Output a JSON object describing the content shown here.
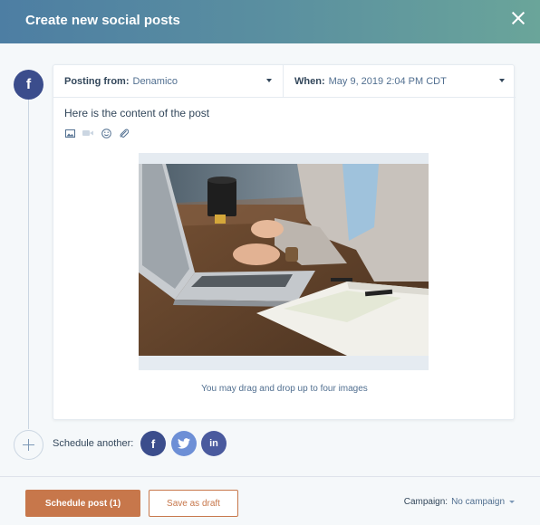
{
  "header": {
    "title": "Create new social posts"
  },
  "post": {
    "network_glyph": "f",
    "posting_from": {
      "label": "Posting from:",
      "value": "Denamico"
    },
    "when": {
      "label": "When:",
      "value": "May 9, 2019 2:04 PM CDT"
    },
    "content": "Here is the content of the post",
    "tools": [
      "image-icon",
      "video-icon",
      "emoji-icon",
      "attachment-icon"
    ],
    "image_hint": "You may drag and drop up to four images"
  },
  "schedule_another": {
    "label": "Schedule another:",
    "networks": [
      {
        "name": "facebook-icon",
        "glyph": "f",
        "color": "#3b4d8c"
      },
      {
        "name": "twitter-icon",
        "glyph": "",
        "color": "#6d8fd6"
      },
      {
        "name": "linkedin-icon",
        "glyph": "in",
        "color": "#4a5a9e"
      }
    ]
  },
  "footer": {
    "schedule_label": "Schedule post (1)",
    "draft_label": "Save as draft",
    "campaign_label": "Campaign:",
    "campaign_value": "No campaign"
  },
  "colors": {
    "accent": "#c7774b",
    "header_start": "#4d7ea3",
    "header_end": "#6aa59a",
    "facebook": "#3b4d8c"
  }
}
